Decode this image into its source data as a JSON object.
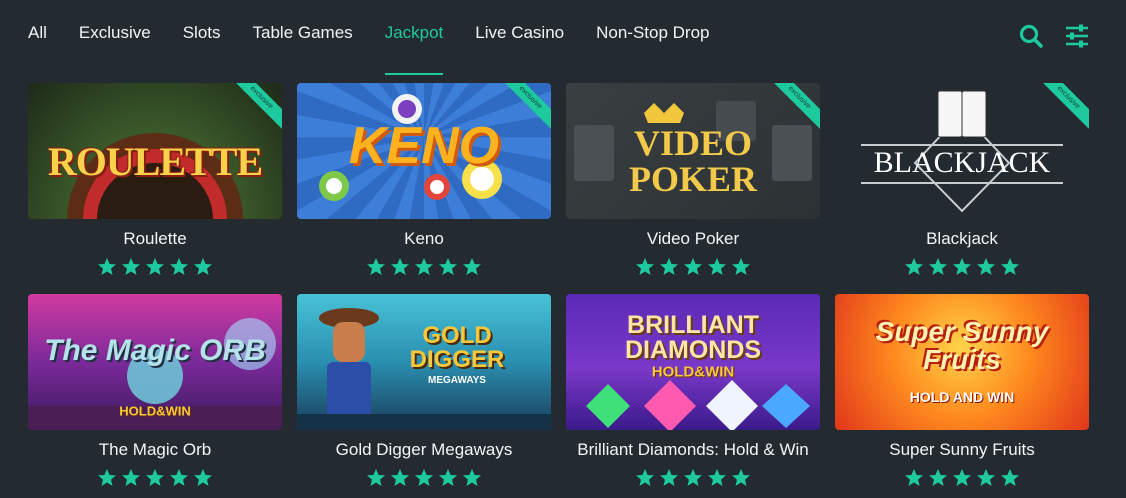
{
  "nav": {
    "tabs": [
      {
        "label": "All",
        "active": false
      },
      {
        "label": "Exclusive",
        "active": false
      },
      {
        "label": "Slots",
        "active": false
      },
      {
        "label": "Table Games",
        "active": false
      },
      {
        "label": "Jackpot",
        "active": true
      },
      {
        "label": "Live Casino",
        "active": false
      },
      {
        "label": "Non-Stop Drop",
        "active": false
      }
    ],
    "icons": [
      "search-icon",
      "filter-sliders-icon"
    ]
  },
  "colors": {
    "accent": "#1ec99e",
    "background": "#232b31"
  },
  "games": [
    {
      "title": "Roulette",
      "thumb_text": "ROULETTE",
      "badge": "exclusive",
      "rating": 5
    },
    {
      "title": "Keno",
      "thumb_text": "KENO",
      "badge": "exclusive",
      "rating": 5
    },
    {
      "title": "Video Poker",
      "thumb_text": "VIDEO POKER",
      "badge": "exclusive",
      "rating": 5
    },
    {
      "title": "Blackjack",
      "thumb_text": "BLACKJACK",
      "badge": "exclusive",
      "rating": 5
    },
    {
      "title": "The Magic Orb",
      "thumb_text": "The Magic ORB",
      "thumb_subtext": "HOLD&WIN",
      "badge": "",
      "rating": 5
    },
    {
      "title": "Gold Digger Megaways",
      "thumb_text": "GOLD DIGGER",
      "thumb_subtext": "MEGAWAYS",
      "badge": "",
      "rating": 5
    },
    {
      "title": "Brilliant Diamonds: Hold & Win",
      "thumb_text": "BRILLIANT DIAMONDS",
      "thumb_subtext": "HOLD&WIN",
      "badge": "",
      "rating": 5
    },
    {
      "title": "Super Sunny Fruits",
      "thumb_text": "Super Sunny Fruits",
      "thumb_subtext": "HOLD AND WIN",
      "badge": "",
      "rating": 5
    }
  ]
}
